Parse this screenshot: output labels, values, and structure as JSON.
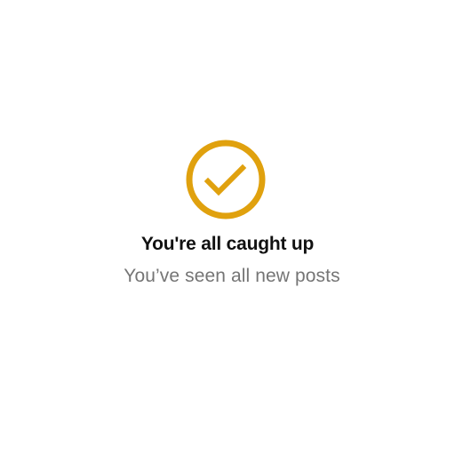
{
  "status": {
    "icon": "check-circle-icon",
    "accent_color": "#E0A10E",
    "title": "You're all caught up",
    "subtitle": "You’ve seen all new posts"
  }
}
